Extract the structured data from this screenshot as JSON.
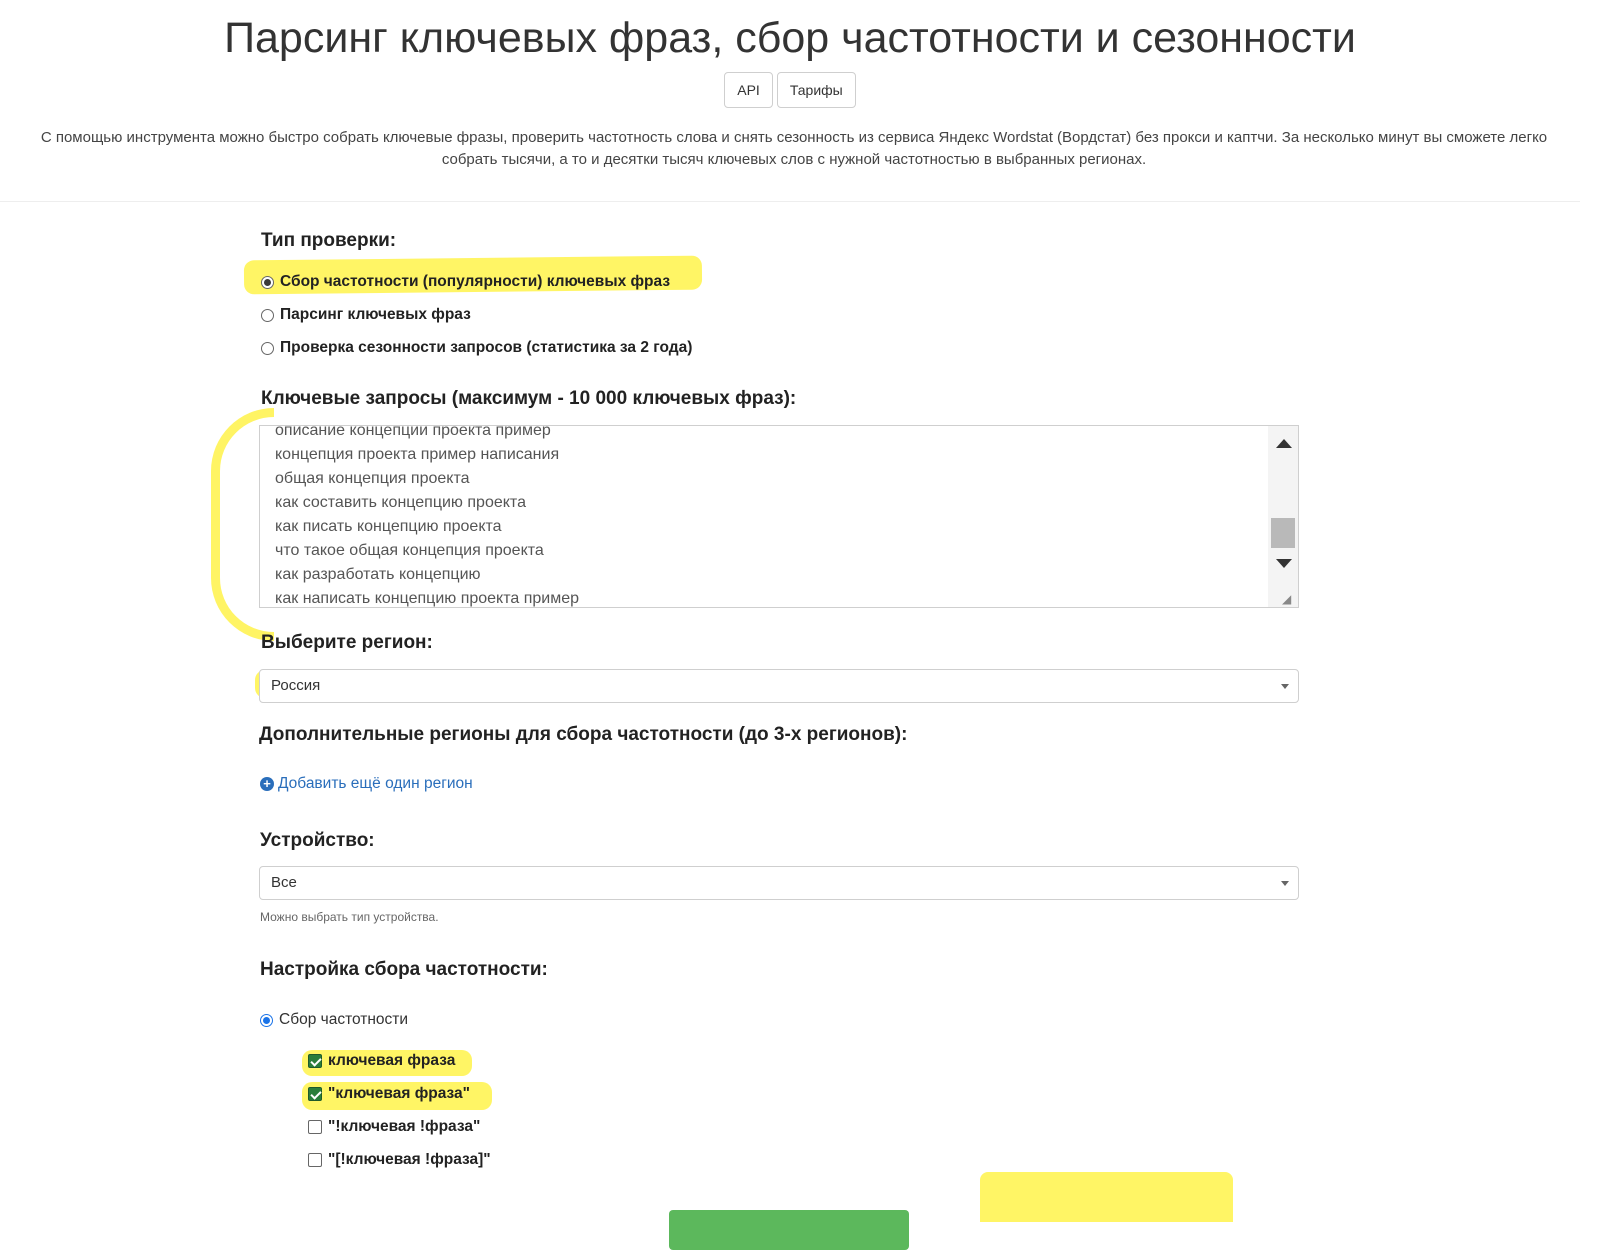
{
  "header": {
    "title": "Парсинг ключевых фраз, сбор частотности и сезонности",
    "buttons": {
      "api": "API",
      "tariffs": "Тарифы"
    },
    "description_line1": "С помощью инструмента можно быстро собрать ключевые фразы, проверить частотность слова и снять сезонность из сервиса Яндекс Wordstat (Вордстат) без прокси и каптчи. За несколько минут вы сможете легко",
    "description_line2": "собрать тысячи, а то и десятки тысяч ключевых слов с нужной частотностью в выбранных регионах."
  },
  "check_type": {
    "label": "Тип проверки:",
    "options": [
      {
        "label": "Сбор частотности (популярности) ключевых фраз",
        "selected": true
      },
      {
        "label": "Парсинг ключевых фраз",
        "selected": false
      },
      {
        "label": "Проверка сезонности запросов (статистика за 2 года)",
        "selected": false
      }
    ]
  },
  "keywords": {
    "label": "Ключевые запросы (максимум - 10 000 ключевых фраз):",
    "lines": [
      "описание концепции проекта пример",
      "концепция проекта пример написания",
      "общая концепция проекта",
      "как составить концепцию проекта",
      "как писать концепцию проекта",
      "что такое общая концепция проекта",
      "как разработать концепцию",
      "как написать концепцию проекта пример"
    ]
  },
  "region": {
    "label": "Выберите регион:",
    "value": "Россия"
  },
  "extra_regions": {
    "label": "Дополнительные регионы для сбора частотности (до 3-х регионов):",
    "add_link": "Добавить ещё один регион"
  },
  "device": {
    "label": "Устройство:",
    "value": "Все",
    "help": "Можно выбрать тип устройства."
  },
  "frequency": {
    "label": "Настройка сбора частотности:",
    "mode": "Сбор частотности",
    "checkboxes": [
      {
        "label": "ключевая фраза",
        "checked": true
      },
      {
        "label": "\"ключевая фраза\"",
        "checked": true
      },
      {
        "label": "\"!ключевая !фраза\"",
        "checked": false
      },
      {
        "label": "\"[!ключевая !фраза]\"",
        "checked": false
      }
    ]
  },
  "highlight_color": "#fff34a",
  "accent_color": "#2a6ebb",
  "submit_color": "#5cb85c"
}
